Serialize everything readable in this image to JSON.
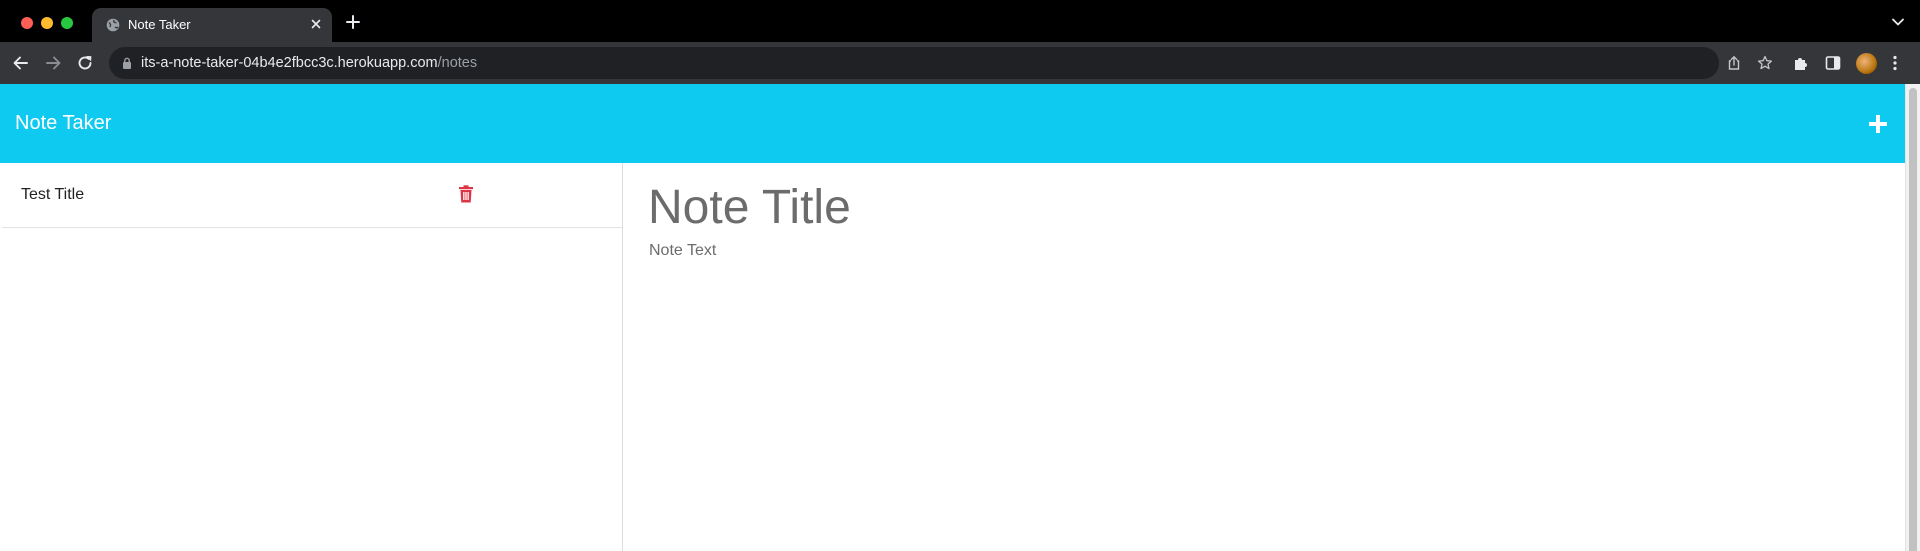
{
  "browser": {
    "tab_title": "Note Taker",
    "url_host": "its-a-note-taker-04b4e2fbcc3c.herokuapp.com",
    "url_path": "/notes"
  },
  "app": {
    "brand": "Note Taker",
    "accent_color": "#0fcaf0",
    "delete_color": "#dc3545"
  },
  "notes": [
    {
      "title": "Test Title"
    }
  ],
  "editor": {
    "title_placeholder": "Note Title",
    "text_placeholder": "Note Text"
  }
}
